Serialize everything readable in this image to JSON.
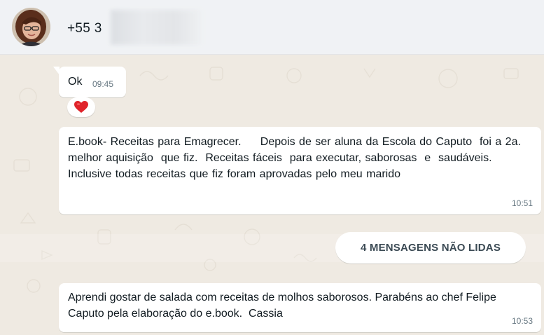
{
  "header": {
    "contact_name": "+55 3"
  },
  "messages": [
    {
      "text": "Ok",
      "time": "09:45",
      "reaction": "heart"
    },
    {
      "text": "E.book- Receitas para Emagrecer.     Depois de ser aluna da Escola do Caputo  foi a 2a. melhor aquisição  que fiz.  Receitas fáceis  para executar, saborosas  e  saudáveis. Inclusive todas receitas que fiz foram aprovadas pelo meu marido",
      "time": "10:51"
    },
    {
      "text": "Aprendi gostar de salada com receitas de molhos saborosos. Parabéns ao chef Felipe  Caputo pela elaboração do e.book.  Cassia",
      "time": "10:53"
    }
  ],
  "unread_divider": {
    "label": "4 MENSAGENS NÃO LIDAS"
  },
  "colors": {
    "background": "#efeae2",
    "header": "#f0f2f5",
    "bubble": "#ffffff",
    "time_text": "#667781",
    "reaction_heart": "#e0242b"
  }
}
